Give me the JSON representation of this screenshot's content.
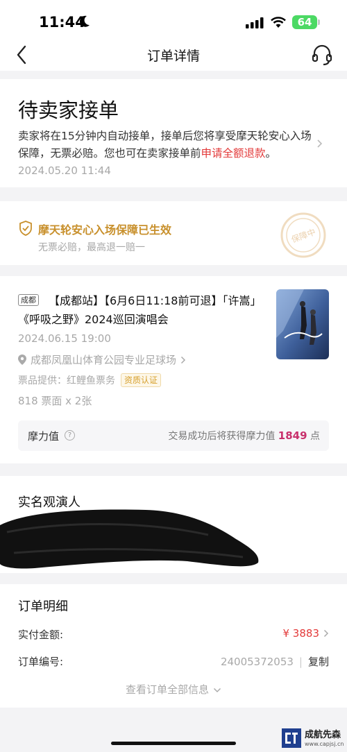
{
  "status_bar": {
    "time": "11:44",
    "battery": "64"
  },
  "nav": {
    "title": "订单详情"
  },
  "order_status": {
    "title": "待卖家接单",
    "desc_prefix": "卖家将在15分钟内自动接单，接单后您将享受摩天轮安心入场保障，无票必赔。您也可在卖家接单前",
    "desc_link": "申请全额退款",
    "desc_suffix": "。",
    "time": "2024.05.20 11:44"
  },
  "guarantee": {
    "title": "摩天轮安心入场保障已生效",
    "subtitle": "无票必赔，最高退一赔一",
    "stamp_text": "保障中"
  },
  "show": {
    "city_tag": "成都",
    "title": "【成都站】【6月6日11:18前可退】「许嵩」《呼吸之野》2024巡回演唱会",
    "datetime": "2024.06.15 19:00",
    "venue": "成都凤凰山体育公园专业足球场",
    "provider_label": "票品提供：红鲤鱼票务",
    "provider_badge": "资质认证",
    "quantity": "818 票面 x 2张",
    "points_label": "摩力值",
    "points_text": "交易成功后将获得摩力值",
    "points_value": "1849",
    "points_unit": "点"
  },
  "attendees": {
    "title": "实名观演人"
  },
  "order_detail": {
    "title": "订单明细",
    "amount_label": "实付金额:",
    "amount_value": "¥ 3883",
    "order_no_label": "订单编号:",
    "order_no_value": "24005372053",
    "separator": "|",
    "copy_label": "复制",
    "view_all_label": "查看订单全部信息"
  },
  "watermark": {
    "name": "成航先森",
    "url": "www.capjsj.cn"
  },
  "colors": {
    "accent_red": "#e33a3a",
    "gold": "#c8902c",
    "points_pink": "#c8306c"
  }
}
